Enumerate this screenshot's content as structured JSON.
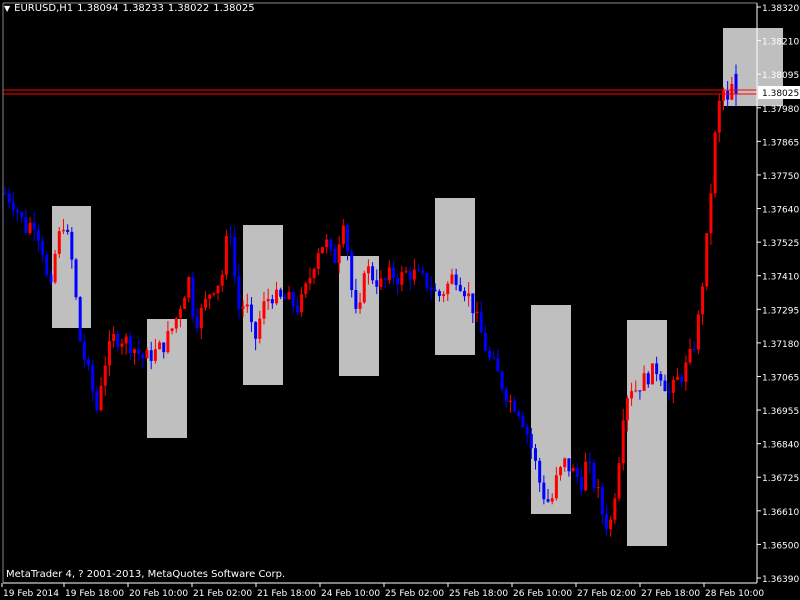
{
  "header": {
    "menu_icon": "dropdown-triangle-icon",
    "symbol": "EURUSD,H1",
    "open": "1.38094",
    "high": "1.38233",
    "low": "1.38022",
    "close": "1.38025"
  },
  "footer": {
    "copyright": "MetaTrader 4, ? 2001-2013, MetaQuotes Software Corp."
  },
  "colors": {
    "background": "#000000",
    "bull": "#ff0000",
    "bear": "#0000ff",
    "axis": "#ffffff",
    "box": "#bfbfbf",
    "price_line": "#ff0000"
  },
  "chart_data": {
    "type": "candlestick",
    "title": "",
    "y_ticks": [
      "1.38320",
      "1.38210",
      "1.38095",
      "1.37980",
      "1.37865",
      "1.37750",
      "1.37640",
      "1.37525",
      "1.37410",
      "1.37295",
      "1.37180",
      "1.37065",
      "1.36955",
      "1.36840",
      "1.36725",
      "1.36610",
      "1.36500",
      "1.36390"
    ],
    "ylim": [
      1.3639,
      1.3832
    ],
    "x_ticks": [
      "19 Feb 2014",
      "19 Feb 18:00",
      "20 Feb 10:00",
      "21 Feb 02:00",
      "21 Feb 18:00",
      "24 Feb 10:00",
      "25 Feb 02:00",
      "25 Feb 18:00",
      "26 Feb 10:00",
      "27 Feb 02:00",
      "27 Feb 18:00",
      "28 Feb 10:00"
    ],
    "current_price": "1.38025",
    "bar_count": 176,
    "path_points": [
      [
        0,
        1.3769
      ],
      [
        8,
        1.3766
      ],
      [
        14,
        1.3762
      ],
      [
        20,
        1.3757
      ],
      [
        28,
        1.376
      ],
      [
        36,
        1.3752
      ],
      [
        44,
        1.3733
      ],
      [
        50,
        1.3751
      ],
      [
        58,
        1.376
      ],
      [
        66,
        1.3745
      ],
      [
        74,
        1.3718
      ],
      [
        82,
        1.3708
      ],
      [
        90,
        1.3696
      ],
      [
        96,
        1.371
      ],
      [
        106,
        1.372
      ],
      [
        116,
        1.372
      ],
      [
        126,
        1.3717
      ],
      [
        136,
        1.3713
      ],
      [
        146,
        1.3715
      ],
      [
        156,
        1.3718
      ],
      [
        166,
        1.3725
      ],
      [
        174,
        1.3734
      ],
      [
        180,
        1.374
      ],
      [
        186,
        1.3725
      ],
      [
        194,
        1.373
      ],
      [
        202,
        1.3737
      ],
      [
        212,
        1.374
      ],
      [
        220,
        1.376
      ],
      [
        228,
        1.373
      ],
      [
        236,
        1.3732
      ],
      [
        244,
        1.3718
      ],
      [
        252,
        1.373
      ],
      [
        260,
        1.3735
      ],
      [
        268,
        1.3733
      ],
      [
        278,
        1.3733
      ],
      [
        288,
        1.373
      ],
      [
        298,
        1.374
      ],
      [
        306,
        1.375
      ],
      [
        314,
        1.3753
      ],
      [
        322,
        1.3745
      ],
      [
        332,
        1.3762
      ],
      [
        340,
        1.3735
      ],
      [
        346,
        1.3723
      ],
      [
        352,
        1.3745
      ],
      [
        362,
        1.374
      ],
      [
        370,
        1.3738
      ],
      [
        378,
        1.3742
      ],
      [
        386,
        1.374
      ],
      [
        392,
        1.3742
      ],
      [
        400,
        1.3742
      ],
      [
        408,
        1.374
      ],
      [
        416,
        1.3738
      ],
      [
        424,
        1.3734
      ],
      [
        432,
        1.3737
      ],
      [
        440,
        1.3742
      ],
      [
        448,
        1.3738
      ],
      [
        456,
        1.3733
      ],
      [
        466,
        1.3722
      ],
      [
        474,
        1.3713
      ],
      [
        480,
        1.371
      ],
      [
        486,
        1.3705
      ],
      [
        494,
        1.3699
      ],
      [
        502,
        1.3697
      ],
      [
        510,
        1.369
      ],
      [
        518,
        1.368
      ],
      [
        526,
        1.3668
      ],
      [
        532,
        1.3665
      ],
      [
        536,
        1.3666
      ],
      [
        540,
        1.3672
      ],
      [
        548,
        1.3678
      ],
      [
        556,
        1.3675
      ],
      [
        566,
        1.3671
      ],
      [
        570,
        1.368
      ],
      [
        574,
        1.3673
      ],
      [
        580,
        1.3669
      ],
      [
        584,
        1.3662
      ],
      [
        592,
        1.3655
      ],
      [
        600,
        1.3675
      ],
      [
        606,
        1.3697
      ],
      [
        612,
        1.3704
      ],
      [
        618,
        1.3703
      ],
      [
        626,
        1.3706
      ],
      [
        632,
        1.3708
      ],
      [
        640,
        1.371
      ],
      [
        646,
        1.3705
      ],
      [
        652,
        1.37
      ],
      [
        656,
        1.3705
      ],
      [
        664,
        1.3708
      ],
      [
        674,
        1.3716
      ],
      [
        680,
        1.3728
      ],
      [
        688,
        1.3755
      ],
      [
        696,
        1.379
      ],
      [
        702,
        1.3805
      ],
      [
        708,
        1.3799
      ],
      [
        712,
        1.3805
      ],
      [
        716,
        1.3803
      ]
    ]
  }
}
